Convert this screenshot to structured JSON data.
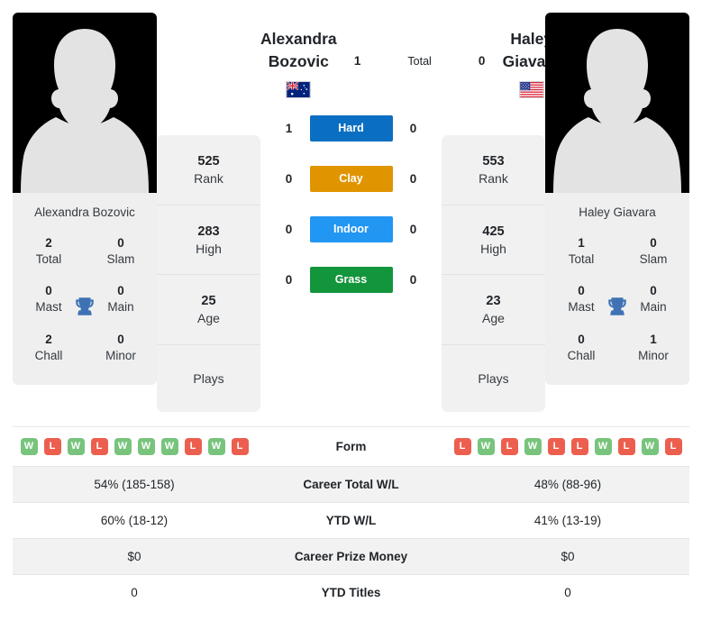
{
  "players": {
    "left": {
      "first_name": "Alexandra",
      "last_name": "Bozovic",
      "full_name": "Alexandra Bozovic",
      "country": "australia-flag",
      "titles": [
        {
          "num": "2",
          "label": "Total"
        },
        {
          "num": "0",
          "label": "Slam"
        },
        {
          "num": "0",
          "label": "Mast"
        },
        {
          "num": "0",
          "label": "Main"
        },
        {
          "num": "2",
          "label": "Chall"
        },
        {
          "num": "0",
          "label": "Minor"
        }
      ],
      "stats": [
        {
          "num": "525",
          "label": "Rank"
        },
        {
          "num": "283",
          "label": "High"
        },
        {
          "num": "25",
          "label": "Age"
        }
      ],
      "plays_label": "Plays",
      "plays_value": "",
      "form": [
        "W",
        "L",
        "W",
        "L",
        "W",
        "W",
        "W",
        "L",
        "W",
        "L"
      ]
    },
    "right": {
      "first_name": "Haley",
      "last_name": "Giavara",
      "full_name": "Haley Giavara",
      "country": "usa-flag",
      "titles": [
        {
          "num": "1",
          "label": "Total"
        },
        {
          "num": "0",
          "label": "Slam"
        },
        {
          "num": "0",
          "label": "Mast"
        },
        {
          "num": "0",
          "label": "Main"
        },
        {
          "num": "0",
          "label": "Chall"
        },
        {
          "num": "1",
          "label": "Minor"
        }
      ],
      "stats": [
        {
          "num": "553",
          "label": "Rank"
        },
        {
          "num": "425",
          "label": "High"
        },
        {
          "num": "23",
          "label": "Age"
        }
      ],
      "plays_label": "Plays",
      "plays_value": "",
      "form": [
        "L",
        "W",
        "L",
        "W",
        "L",
        "L",
        "W",
        "L",
        "W",
        "L"
      ]
    }
  },
  "h2h": {
    "total": {
      "label": "Total",
      "left": "1",
      "right": "0"
    },
    "surfaces": [
      {
        "label": "Hard",
        "left": "1",
        "right": "0",
        "color": "#0a6fc2"
      },
      {
        "label": "Clay",
        "left": "0",
        "right": "0",
        "color": "#e09400"
      },
      {
        "label": "Indoor",
        "left": "0",
        "right": "0",
        "color": "#2196f3"
      },
      {
        "label": "Grass",
        "left": "0",
        "right": "0",
        "color": "#13953c"
      }
    ]
  },
  "table": {
    "form_label": "Form",
    "rows": [
      {
        "label": "Career Total W/L",
        "left": "54% (185-158)",
        "right": "48% (88-96)"
      },
      {
        "label": "YTD W/L",
        "left": "60% (18-12)",
        "right": "41% (13-19)"
      },
      {
        "label": "Career Prize Money",
        "left": "$0",
        "right": "$0"
      },
      {
        "label": "YTD Titles",
        "left": "0",
        "right": "0"
      }
    ]
  },
  "colors": {
    "form_win": "#78c47d",
    "form_loss": "#ec5f4e",
    "trophy": "#3f72b4",
    "card_bg": "#f1f1f1",
    "shaded_row": "#f2f2f2"
  },
  "icons": {
    "trophy": "trophy-icon"
  }
}
